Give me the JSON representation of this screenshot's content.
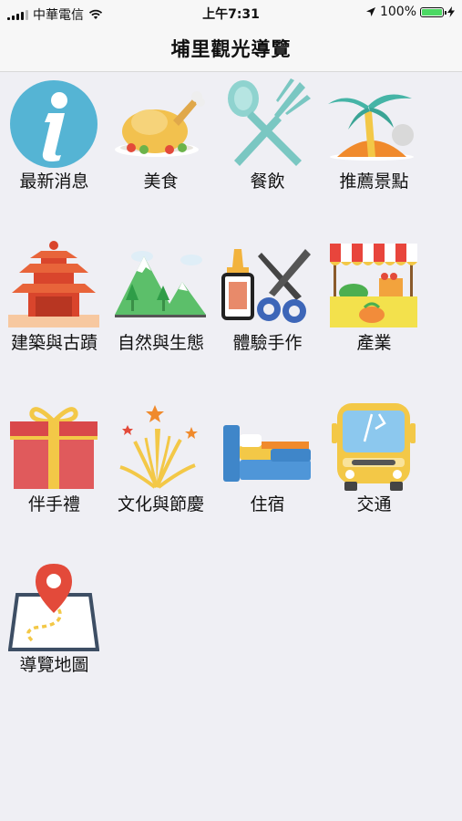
{
  "status": {
    "carrier": "中華電信",
    "time": "上午7:31",
    "battery": "100%",
    "battery_level": 1.0
  },
  "nav": {
    "title": "埔里觀光導覽"
  },
  "menu": [
    {
      "label": "最新消息",
      "icon": "info-icon"
    },
    {
      "label": "美食",
      "icon": "roast-chicken-icon"
    },
    {
      "label": "餐飲",
      "icon": "fork-spoon-icon"
    },
    {
      "label": "推薦景點",
      "icon": "palm-island-icon"
    },
    {
      "label": "建築與古蹟",
      "icon": "temple-icon"
    },
    {
      "label": "自然與生態",
      "icon": "mountain-icon"
    },
    {
      "label": "體驗手作",
      "icon": "glue-scissors-icon"
    },
    {
      "label": "產業",
      "icon": "market-stall-icon"
    },
    {
      "label": "伴手禮",
      "icon": "gift-box-icon"
    },
    {
      "label": "文化與節慶",
      "icon": "fireworks-icon"
    },
    {
      "label": "住宿",
      "icon": "bed-icon"
    },
    {
      "label": "交通",
      "icon": "bus-icon"
    },
    {
      "label": "導覽地圖",
      "icon": "map-pin-icon"
    }
  ],
  "colors": {
    "background": "#efeff4",
    "bar": "#f7f7f7",
    "battery_green": "#4cd964"
  }
}
